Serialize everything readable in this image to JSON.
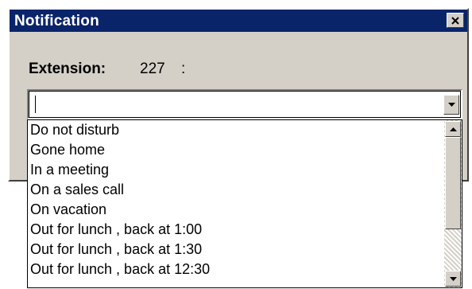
{
  "window": {
    "title": "Notification",
    "close_icon": "close-x-icon"
  },
  "extension": {
    "label": "Extension:",
    "value": "227",
    "separator": ":"
  },
  "combo": {
    "value": "",
    "arrow_icon": "chevron-down-icon"
  },
  "dropdown": {
    "items": [
      "Do not disturb",
      "Gone home",
      "In a meeting",
      "On a sales call",
      "On vacation",
      "Out for lunch , back at 1:00",
      "Out for lunch , back at 1:30",
      "Out for lunch , back at 12:30"
    ],
    "scroll_up_icon": "scroll-up-arrow-icon",
    "scroll_down_icon": "scroll-down-arrow-icon"
  },
  "colors": {
    "titlebar": "#0a246a",
    "dialog_face": "#d4d0c8"
  }
}
